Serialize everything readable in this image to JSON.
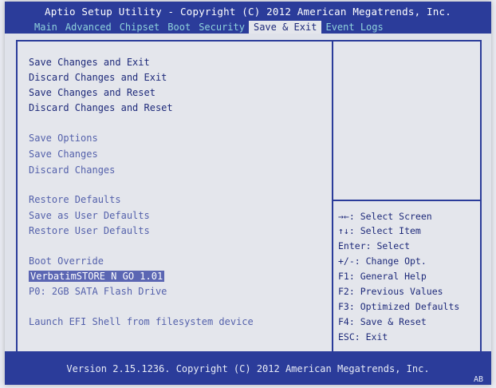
{
  "header": {
    "title": "Aptio Setup Utility - Copyright (C) 2012 American Megatrends, Inc.",
    "tabs": [
      "Main",
      "Advanced",
      "Chipset",
      "Boot",
      "Security",
      "Save & Exit",
      "Event Logs"
    ],
    "active_tab": "Save & Exit"
  },
  "menu": {
    "save_changes_and_exit": "Save Changes and Exit",
    "discard_changes_and_exit": "Discard Changes and Exit",
    "save_changes_and_reset": "Save Changes and Reset",
    "discard_changes_and_reset": "Discard Changes and Reset",
    "save_options": "Save Options",
    "save_changes": "Save Changes",
    "discard_changes": "Discard Changes",
    "restore_defaults": "Restore Defaults",
    "save_as_user_defaults": "Save as User Defaults",
    "restore_user_defaults": "Restore User Defaults",
    "boot_override": "Boot Override",
    "boot_device_1": "VerbatimSTORE N GO 1.01",
    "boot_device_2": "P0: 2GB SATA Flash Drive",
    "launch_efi_shell": "Launch EFI Shell from filesystem device"
  },
  "help": {
    "select_screen": "→←: Select Screen",
    "select_item": "↑↓: Select Item",
    "enter_select": "Enter: Select",
    "change_opt": "+/-: Change Opt.",
    "f1": "F1: General Help",
    "f2": "F2: Previous Values",
    "f3": "F3: Optimized Defaults",
    "f4": "F4: Save & Reset",
    "esc": "ESC: Exit"
  },
  "footer": {
    "version": "Version 2.15.1236. Copyright (C) 2012 American Megatrends, Inc.",
    "corner": "AB"
  },
  "colors": {
    "bar": "#2b3c9a",
    "panel": "#e4e6ec",
    "text": "#1e2a7a",
    "tab_inactive": "#8fd2dc"
  }
}
